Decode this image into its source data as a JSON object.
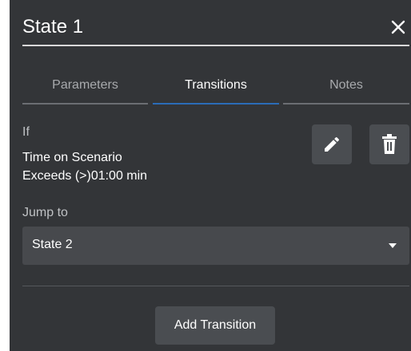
{
  "header": {
    "title": "State 1",
    "close_icon": "close-icon"
  },
  "tabs": [
    {
      "label": "Parameters",
      "active": false
    },
    {
      "label": "Transitions",
      "active": true
    },
    {
      "label": "Notes",
      "active": false
    }
  ],
  "transition": {
    "condition_label": "If",
    "condition_line1": "Time on Scenario",
    "condition_line2": "Exceeds (>)01:00 min",
    "edit_icon": "pencil-icon",
    "delete_icon": "trash-icon"
  },
  "jump": {
    "label": "Jump to",
    "selected": "State 2"
  },
  "actions": {
    "add_transition": "Add Transition"
  },
  "colors": {
    "panel_bg": "#333538",
    "active_tab_underline": "#2b6cb8",
    "button_bg": "#4a4d51",
    "select_bg": "#47494d"
  }
}
